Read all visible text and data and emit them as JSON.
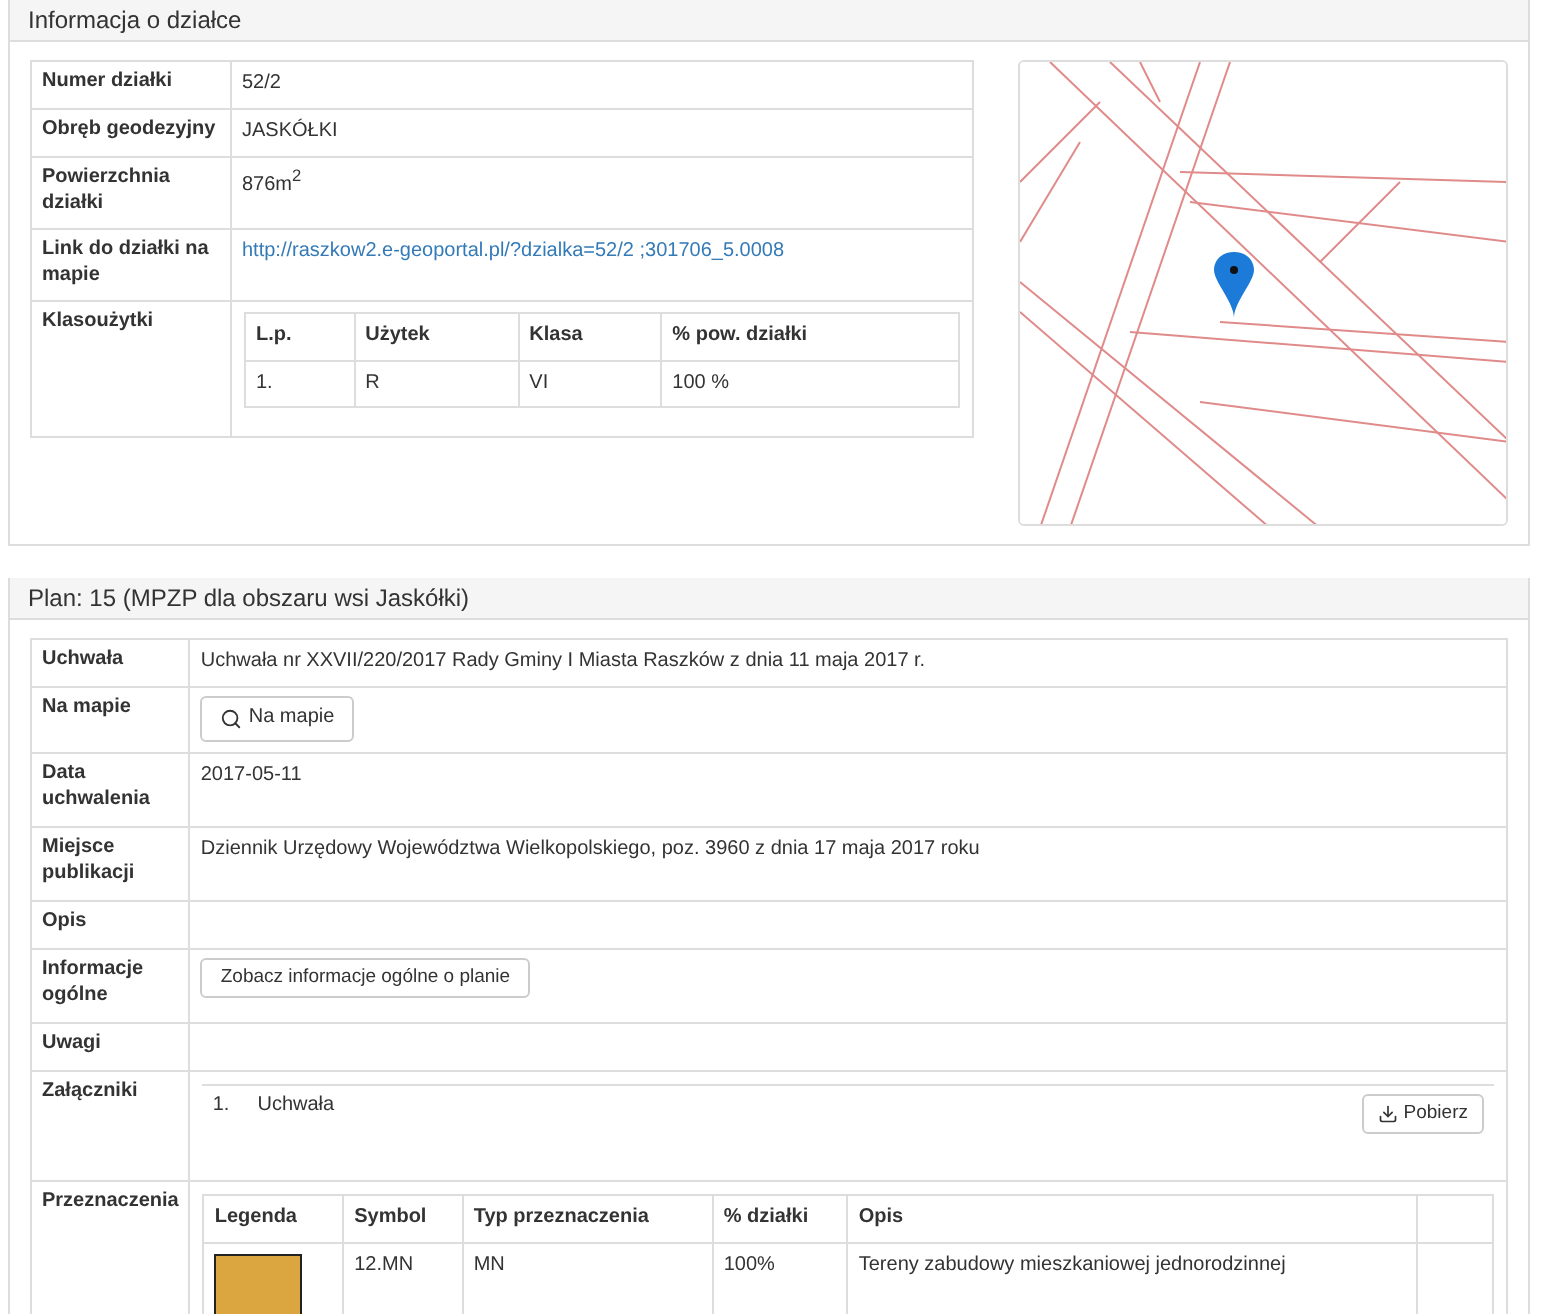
{
  "parcel_panel": {
    "title": "Informacja o działce",
    "rows": [
      {
        "label": "Numer działki",
        "kind": "text",
        "value": "52/2"
      },
      {
        "label": "Obręb geodezyjny",
        "kind": "text",
        "value": "JASKÓŁKI"
      },
      {
        "label": "Powierzchnia działki",
        "kind": "text",
        "value": "876m$^{2}$"
      },
      {
        "label": "Link do działki na mapie",
        "kind": "link",
        "value": "http://raszkow2.e-geoportal.pl/?dzialka=52/2 ;301706_5.0008"
      },
      {
        "label": "Klasoużytki",
        "kind": "table",
        "columns": [
          "L.p.",
          "Użytek",
          "Klasa",
          "% pow. działki"
        ],
        "rows": [
          [
            "1.",
            "R",
            "VI",
            "100 %"
          ]
        ]
      }
    ]
  },
  "plan_panel": {
    "title": "Plan: 15 (MPZP dla obszaru wsi Jaskółki)",
    "rows": [
      {
        "label": "Uchwała",
        "kind": "text",
        "value": "Uchwała nr XXVII/220/2017 Rady Gminy I Miasta Raszków z dnia 11 maja 2017 r."
      },
      {
        "label": "Na mapie",
        "kind": "map_button",
        "value": "Na mapie"
      },
      {
        "label": "Data uchwalenia",
        "kind": "text",
        "value": "2017-05-11"
      },
      {
        "label": "Miejsce publikacji",
        "kind": "text",
        "value": "Dziennik Urzędowy Województwa Wielkopolskiego, poz. 3960 z dnia 17 maja 2017 roku"
      },
      {
        "label": "Opis",
        "kind": "empty"
      },
      {
        "label": "Informacje ogólne",
        "kind": "button",
        "value": "Zobacz informacje ogólne o planie"
      },
      {
        "label": "Uwagi",
        "kind": "empty"
      },
      {
        "label": "Załączniki",
        "kind": "attachments",
        "items": [
          {
            "number": "1.",
            "name": "Uchwała",
            "action": "Pobierz"
          }
        ]
      },
      {
        "label": "Przeznaczenia",
        "kind": "zoning",
        "columns": [
          "Legenda",
          "Symbol",
          "Typ przeznaczenia",
          "% działki",
          "Opis"
        ],
        "rows": [
          {
            "color": "#dba640",
            "symbol": "12.MN",
            "type": "MN",
            "share": "100%",
            "description": "Tereny zabudowy mieszkaniowej jednorodzinnej"
          }
        ]
      }
    ]
  }
}
